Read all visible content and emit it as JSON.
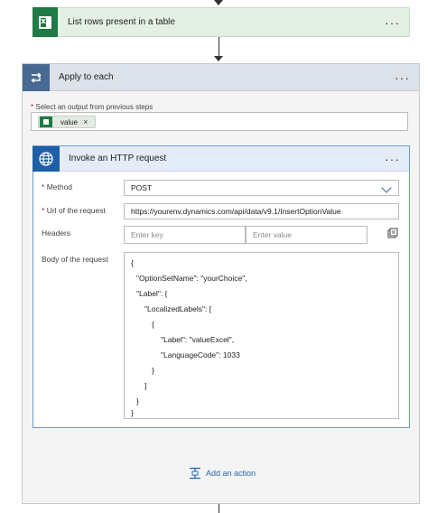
{
  "flow": {
    "list_rows_step": {
      "title": "List rows present in a table",
      "more": "···",
      "icon": "excel-icon"
    },
    "apply_to_each": {
      "title": "Apply to each",
      "more": "···",
      "select_label_required": "*",
      "select_label": "Select an output from previous steps",
      "token": {
        "label": "value",
        "remove": "×"
      }
    },
    "http_request": {
      "title": "Invoke an HTTP request",
      "more": "···",
      "method": {
        "required": "*",
        "label": "Method",
        "value": "POST"
      },
      "url": {
        "required": "*",
        "label": "Url of the request",
        "value": "https://yourenv.dynamics.com/api/data/v9.1/InsertOptionValue"
      },
      "headers": {
        "label": "Headers",
        "key_placeholder": "Enter key",
        "value_placeholder": "Enter value"
      },
      "body": {
        "label": "Body of the request",
        "lines": [
          "{",
          "\"OptionSetName\": \"yourChoice\",",
          "\"Label\": {",
          "\"LocalizedLabels\": [",
          "{",
          "\"Label\": \"valueExcel\",",
          "\"LanguageCode\": 1033",
          "}",
          "]",
          "}",
          "}"
        ]
      }
    },
    "add_action": "Add an action"
  },
  "colors": {
    "excel_green": "#1f7a45",
    "loop_blue": "#486991",
    "http_blue": "#1f5fa8",
    "link_blue": "#2a66b2"
  }
}
